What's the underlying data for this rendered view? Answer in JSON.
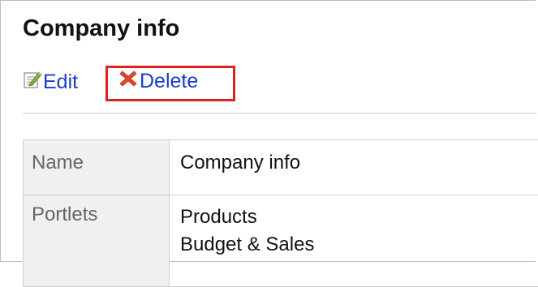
{
  "page": {
    "title": "Company info"
  },
  "toolbar": {
    "edit_label": "Edit",
    "delete_label": "Delete",
    "highlight_color": "#e0201c",
    "link_color": "#1a3cc8"
  },
  "details": {
    "name_label": "Name",
    "name_value": "Company info",
    "portlets_label": "Portlets",
    "portlets": [
      "Products",
      "Budget & Sales"
    ]
  }
}
